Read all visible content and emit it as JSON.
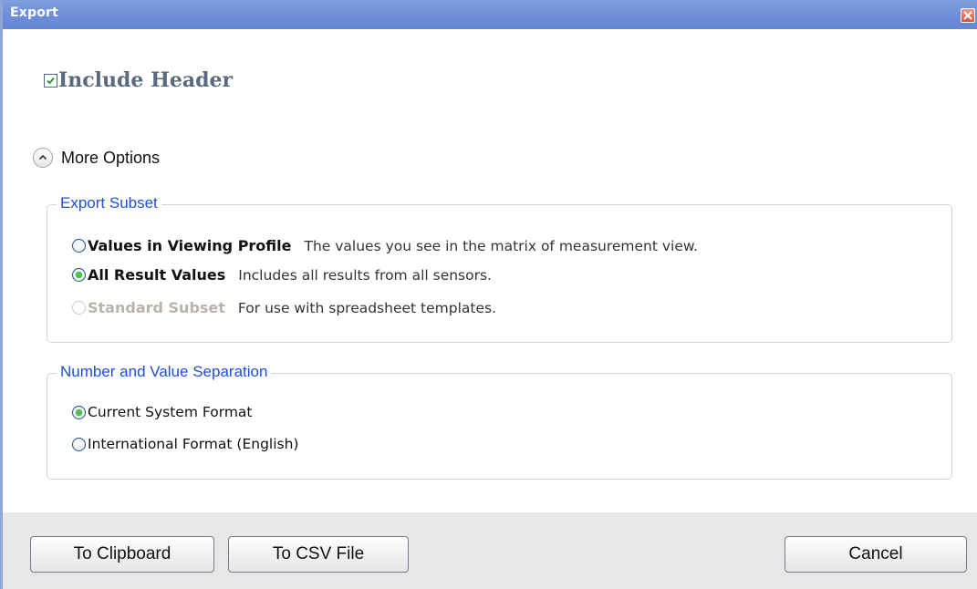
{
  "window": {
    "title": "Export",
    "close_icon": "close-icon"
  },
  "include_header": {
    "label": "Include Header",
    "checked": true
  },
  "more_options": {
    "label": "More Options",
    "expanded": true
  },
  "export_subset": {
    "title": "Export Subset",
    "options": [
      {
        "label": "Values in Viewing Profile",
        "description": "The values you see in the matrix of measurement view.",
        "selected": false,
        "enabled": true
      },
      {
        "label": "All Result Values",
        "description": "Includes all results from all sensors.",
        "selected": true,
        "enabled": true
      },
      {
        "label": "Standard Subset",
        "description": "For use with spreadsheet templates.",
        "selected": false,
        "enabled": false
      }
    ]
  },
  "number_separation": {
    "title": "Number and Value Separation",
    "options": [
      {
        "label": "Current System Format",
        "selected": true
      },
      {
        "label": "International Format (English)",
        "selected": false
      }
    ]
  },
  "buttons": {
    "clipboard": "To Clipboard",
    "csv": "To CSV File",
    "cancel": "Cancel"
  },
  "colors": {
    "titlebar": "#6f8fd8",
    "group_title": "#1f4fd6",
    "radio_selected": "#4cc04c",
    "header_text": "#5a6a7e"
  }
}
